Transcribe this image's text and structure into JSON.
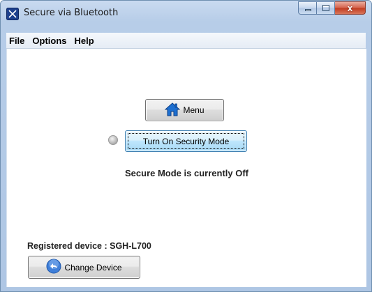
{
  "window": {
    "title": "Secure via Bluetooth",
    "close_glyph": "x"
  },
  "menu": {
    "items": [
      "File",
      "Options",
      "Help"
    ]
  },
  "buttons": {
    "menu_label": "Menu",
    "security_label": "Turn On Security Mode",
    "change_device_label": "Change Device"
  },
  "status": {
    "secure_mode_text": "Secure Mode is currently Off",
    "registered_device_text": "Registered device : SGH-L700",
    "indicator_state": "off"
  },
  "icons": {
    "app": "bluetooth-app-icon",
    "menu": "home-icon",
    "change_device": "back-arrow-icon",
    "indicator": "status-led-icon"
  },
  "colors": {
    "title_bar": "#b7cde8",
    "close_button": "#c03a1f",
    "focused_button": "#bee6fd",
    "home_icon": "#1d6fd0"
  }
}
